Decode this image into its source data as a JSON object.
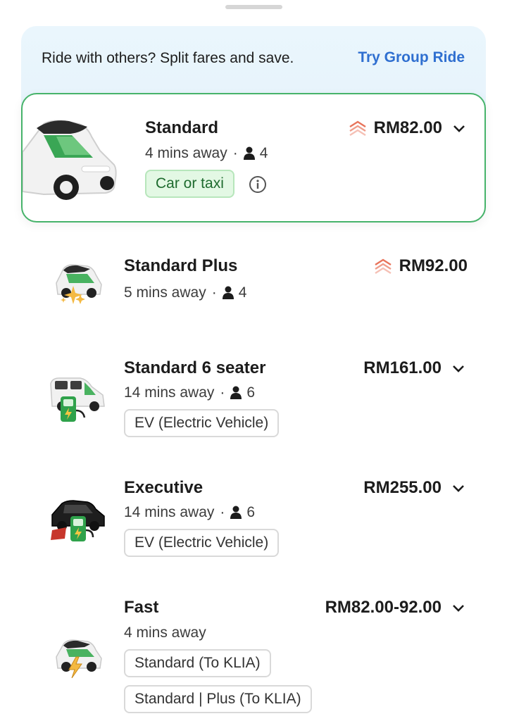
{
  "promo": {
    "text": "Ride with others? Split fares and save.",
    "link": "Try Group Ride"
  },
  "rides": [
    {
      "name": "Standard",
      "eta": "4 mins away",
      "seats": "4",
      "price": "RM82.00",
      "surge": true,
      "expand": true,
      "tags": [
        "Car or taxi"
      ],
      "selected": true,
      "icon": "white-car-icon"
    },
    {
      "name": "Standard Plus",
      "eta": "5 mins away",
      "seats": "4",
      "price": "RM92.00",
      "surge": true,
      "expand": false,
      "tags": [],
      "icon": "sparkle-car-icon"
    },
    {
      "name": "Standard 6 seater",
      "eta": "14 mins away",
      "seats": "6",
      "price": "RM161.00",
      "surge": false,
      "expand": true,
      "tags": [
        "EV (Electric Vehicle)"
      ],
      "icon": "ev-van-icon"
    },
    {
      "name": "Executive",
      "eta": "14 mins away",
      "seats": "6",
      "price": "RM255.00",
      "surge": false,
      "expand": true,
      "tags": [
        "EV (Electric Vehicle)"
      ],
      "icon": "ev-executive-car-icon"
    },
    {
      "name": "Fast",
      "eta": "4 mins away",
      "price": "RM82.00-92.00",
      "surge": false,
      "expand": true,
      "tags": [
        "Standard (To KLIA)",
        "Standard | Plus (To KLIA)"
      ],
      "icon": "lightning-car-icon"
    }
  ],
  "colors": {
    "accent_link": "#2f6fd0",
    "selected_border": "#46b36a",
    "surge": "#e8735a",
    "green_tag_bg": "#e3f8e4"
  }
}
